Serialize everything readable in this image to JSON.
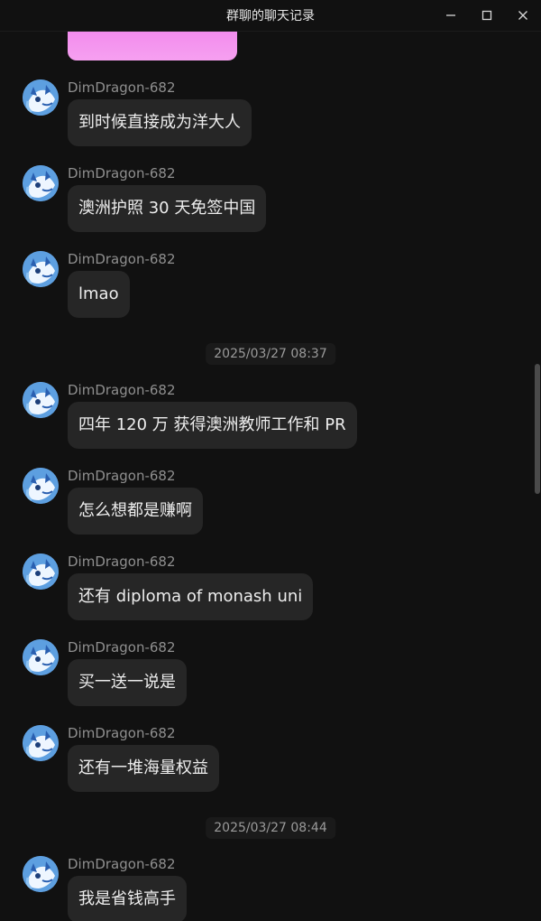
{
  "window": {
    "title": "群聊的聊天记录",
    "minimize_icon": "minimize-icon",
    "maximize_icon": "maximize-icon",
    "close_icon": "close-icon"
  },
  "colors": {
    "background": "#111111",
    "bubble": "#262626",
    "sender": "#8f8f8f",
    "text": "#ededed",
    "image_pink": "#f080ec",
    "avatar_blue": "#6aa7e6"
  },
  "timestamps": [
    "2025/03/27 08:37",
    "2025/03/27 08:44"
  ],
  "messages": [
    {
      "sender": "DimDragon-682",
      "text": "到时候直接成为洋大人"
    },
    {
      "sender": "DimDragon-682",
      "text": "澳洲护照 30 天免签中国"
    },
    {
      "sender": "DimDragon-682",
      "text": "lmao"
    },
    {
      "sender": "DimDragon-682",
      "text": "四年 120 万 获得澳洲教师工作和 PR"
    },
    {
      "sender": "DimDragon-682",
      "text": "怎么想都是赚啊"
    },
    {
      "sender": "DimDragon-682",
      "text": "还有 diploma of monash uni"
    },
    {
      "sender": "DimDragon-682",
      "text": "买一送一说是"
    },
    {
      "sender": "DimDragon-682",
      "text": "还有一堆海量权益"
    },
    {
      "sender": "DimDragon-682",
      "text": "我是省钱高手"
    }
  ]
}
